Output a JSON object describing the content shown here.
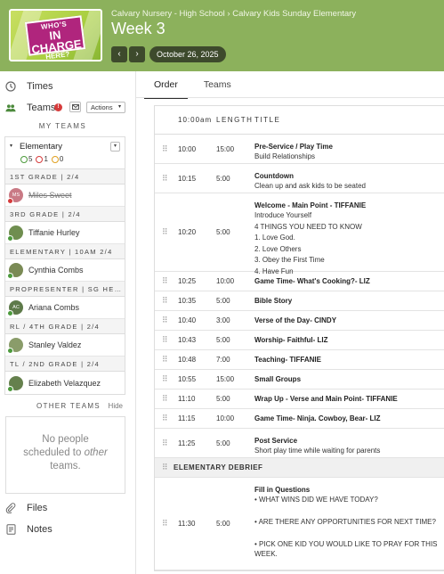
{
  "header": {
    "thumbnail": {
      "line1": "WHO'S",
      "line2": "IN CHARGE",
      "line3": "HERE?"
    },
    "breadcrumb": "Calvary Nursery - High School › Calvary Kids Sunday Elementary",
    "title": "Week 3",
    "prev_icon": "‹",
    "next_icon": "›",
    "date": "October 26, 2025",
    "colors": {
      "bar": "#8cb15c",
      "dark": "#3d4a2c"
    }
  },
  "sidebar": {
    "times_label": "Times",
    "teams_label": "Teams",
    "actions_label": "Actions",
    "my_teams_label": "MY TEAMS",
    "team": {
      "name": "Elementary",
      "confirmed": "5",
      "declined": "1",
      "pending": "0"
    },
    "positions": [
      {
        "header": "1ST GRADE | 2/4",
        "people": [
          {
            "name": "Miles Sweet",
            "initials": "MS",
            "status": "declined"
          }
        ]
      },
      {
        "header": "3RD GRADE | 2/4",
        "people": [
          {
            "name": "Tiffanie Hurley",
            "status": "confirmed"
          }
        ]
      },
      {
        "header": "ELEMENTARY | 10AM 2/4",
        "people": [
          {
            "name": "Cynthia Combs",
            "status": "confirmed"
          }
        ]
      },
      {
        "header": "PROPRESENTER | SG HEL...",
        "people": [
          {
            "name": "Ariana Combs",
            "initials": "AC",
            "status": "confirmed"
          }
        ]
      },
      {
        "header": "RL / 4TH GRADE | 2/4",
        "people": [
          {
            "name": "Stanley Valdez",
            "status": "confirmed"
          }
        ]
      },
      {
        "header": "TL / 2ND GRADE | 2/4",
        "people": [
          {
            "name": "Elizabeth Velazquez",
            "status": "confirmed"
          }
        ]
      }
    ],
    "other_teams_label": "OTHER TEAMS",
    "hide_label": "Hide",
    "other_empty_1": "No people",
    "other_empty_2": "scheduled to",
    "other_empty_3": "other",
    "other_empty_4": "teams.",
    "files_label": "Files",
    "notes_label": "Notes"
  },
  "main": {
    "tabs": [
      "Order",
      "Teams"
    ],
    "columns": {
      "time": "10:00am",
      "length": "LENGTH",
      "title": "TITLE"
    },
    "rows": [
      {
        "time": "10:00",
        "length": "15:00",
        "title": "Pre-Service / Play Time",
        "desc": [
          "Build Relationships"
        ]
      },
      {
        "time": "10:15",
        "length": "5:00",
        "title": "Countdown",
        "desc": [
          "Clean up and ask kids to be seated"
        ]
      },
      {
        "time": "10:20",
        "length": "5:00",
        "title": "Welcome - Main Point - TIFFANIE",
        "desc": [
          "Introduce Yourself",
          "4 THINGS YOU NEED TO KNOW",
          "1. Love God.",
          "2. Love Others",
          "3. Obey the First Time",
          "4. Have Fun"
        ]
      },
      {
        "time": "10:25",
        "length": "10:00",
        "title": "Game Time- What's Cooking?- LIZ",
        "desc": []
      },
      {
        "time": "10:35",
        "length": "5:00",
        "title": "Bible Story",
        "desc": []
      },
      {
        "time": "10:40",
        "length": "3:00",
        "title": "Verse of the Day- CINDY",
        "desc": []
      },
      {
        "time": "10:43",
        "length": "5:00",
        "title": "Worship- Faithful- LIZ",
        "desc": []
      },
      {
        "time": "10:48",
        "length": "7:00",
        "title": "Teaching- TIFFANIE",
        "desc": []
      },
      {
        "time": "10:55",
        "length": "15:00",
        "title": "Small Groups",
        "desc": []
      },
      {
        "time": "11:10",
        "length": "5:00",
        "title": "Wrap Up - Verse and Main Point- TIFFANIE",
        "desc": []
      },
      {
        "time": "11:15",
        "length": "10:00",
        "title": "Game Time- Ninja. Cowboy, Bear- LIZ",
        "desc": []
      },
      {
        "time": "11:25",
        "length": "5:00",
        "title": "Post Service",
        "desc": [
          "Short play time while waiting for parents"
        ]
      },
      {
        "section": "ELEMENTARY DEBRIEF"
      },
      {
        "time": "11:30",
        "length": "5:00",
        "title": "Fill in Questions",
        "desc": [
          "• WHAT WINS DID WE HAVE TODAY?",
          "",
          "• ARE THERE ANY OPPORTUNITIES FOR NEXT TIME?",
          "",
          "• PICK ONE KID YOU WOULD LIKE TO PRAY FOR THIS WEEK."
        ]
      }
    ]
  }
}
